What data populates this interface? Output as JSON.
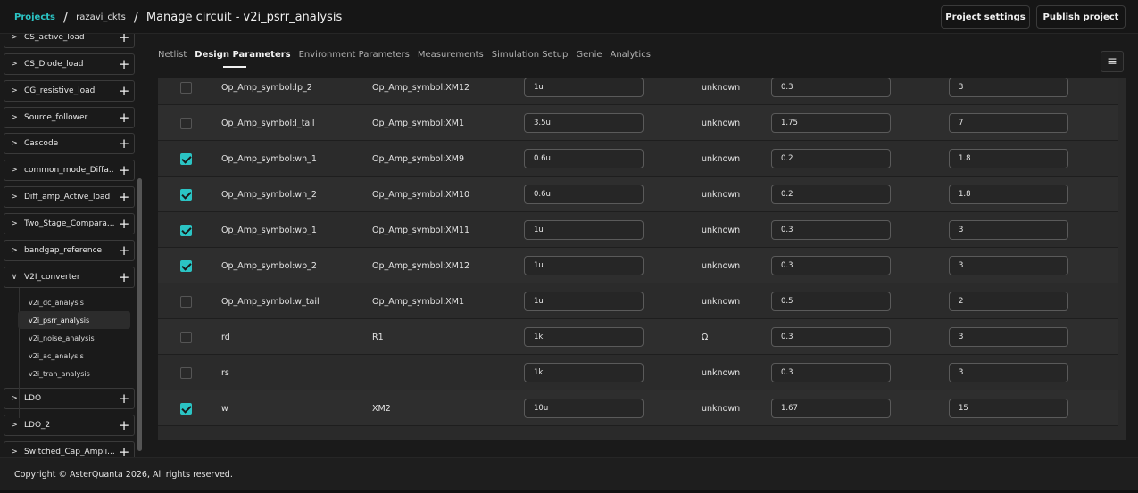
{
  "header": {
    "crumb_projects": "Projects",
    "crumb_sep": "/",
    "crumb_folder": "razavi_ckts",
    "crumb_title": "Manage circuit - v2i_psrr_analysis",
    "btn_settings": "Project settings",
    "btn_publish": "Publish project"
  },
  "sidebar": {
    "items": [
      {
        "label": "CS_active_load",
        "chev": ">",
        "plus": "+"
      },
      {
        "label": "CS_Diode_load",
        "chev": ">",
        "plus": "+"
      },
      {
        "label": "CG_resistive_load",
        "chev": ">",
        "plus": "+"
      },
      {
        "label": "Source_follower",
        "chev": ">",
        "plus": "+"
      },
      {
        "label": "Cascode",
        "chev": ">",
        "plus": "+"
      },
      {
        "label": "common_mode_Diffa...",
        "chev": ">",
        "plus": "+"
      },
      {
        "label": "Diff_amp_Active_load",
        "chev": ">",
        "plus": "+"
      },
      {
        "label": "Two_Stage_Compara...",
        "chev": ">",
        "plus": "+"
      },
      {
        "label": "bandgap_reference",
        "chev": ">",
        "plus": "+"
      },
      {
        "label": "V2I_converter",
        "chev": "∨",
        "plus": "+"
      },
      {
        "label": "LDO",
        "chev": ">",
        "plus": "+"
      },
      {
        "label": "LDO_2",
        "chev": ">",
        "plus": "+"
      },
      {
        "label": "Switched_Cap_Ampli...",
        "chev": ">",
        "plus": "+"
      }
    ],
    "children": [
      "v2i_dc_analysis",
      "v2i_psrr_analysis",
      "v2i_noise_analysis",
      "v2i_ac_analysis",
      "v2i_tran_analysis"
    ],
    "active_child": "v2i_psrr_analysis"
  },
  "tabs": [
    "Netlist",
    "Design Parameters",
    "Environment Parameters",
    "Measurements",
    "Simulation Setup",
    "Genie",
    "Analytics"
  ],
  "active_tab": "Design Parameters",
  "menu_icon": "≡",
  "rows": [
    {
      "checked": false,
      "name": "Op_Amp_symbol:lp_2",
      "instance": "Op_Amp_symbol:XM12",
      "value": "1u",
      "unit": "unknown",
      "min": "0.3",
      "max": "3"
    },
    {
      "checked": false,
      "name": "Op_Amp_symbol:l_tail",
      "instance": "Op_Amp_symbol:XM1",
      "value": "3.5u",
      "unit": "unknown",
      "min": "1.75",
      "max": "7"
    },
    {
      "checked": true,
      "name": "Op_Amp_symbol:wn_1",
      "instance": "Op_Amp_symbol:XM9",
      "value": "0.6u",
      "unit": "unknown",
      "min": "0.2",
      "max": "1.8"
    },
    {
      "checked": true,
      "name": "Op_Amp_symbol:wn_2",
      "instance": "Op_Amp_symbol:XM10",
      "value": "0.6u",
      "unit": "unknown",
      "min": "0.2",
      "max": "1.8"
    },
    {
      "checked": true,
      "name": "Op_Amp_symbol:wp_1",
      "instance": "Op_Amp_symbol:XM11",
      "value": "1u",
      "unit": "unknown",
      "min": "0.3",
      "max": "3"
    },
    {
      "checked": true,
      "name": "Op_Amp_symbol:wp_2",
      "instance": "Op_Amp_symbol:XM12",
      "value": "1u",
      "unit": "unknown",
      "min": "0.3",
      "max": "3"
    },
    {
      "checked": false,
      "name": "Op_Amp_symbol:w_tail",
      "instance": "Op_Amp_symbol:XM1",
      "value": "1u",
      "unit": "unknown",
      "min": "0.5",
      "max": "2"
    },
    {
      "checked": false,
      "name": "rd",
      "instance": "R1",
      "value": "1k",
      "unit": "Ω",
      "min": "0.3",
      "max": "3"
    },
    {
      "checked": false,
      "name": "rs",
      "instance": "",
      "value": "1k",
      "unit": "unknown",
      "min": "0.3",
      "max": "3"
    },
    {
      "checked": true,
      "name": "w",
      "instance": "XM2",
      "value": "10u",
      "unit": "unknown",
      "min": "1.67",
      "max": "15"
    }
  ],
  "footer": "Copyright © AsterQuanta 2026, All rights reserved."
}
